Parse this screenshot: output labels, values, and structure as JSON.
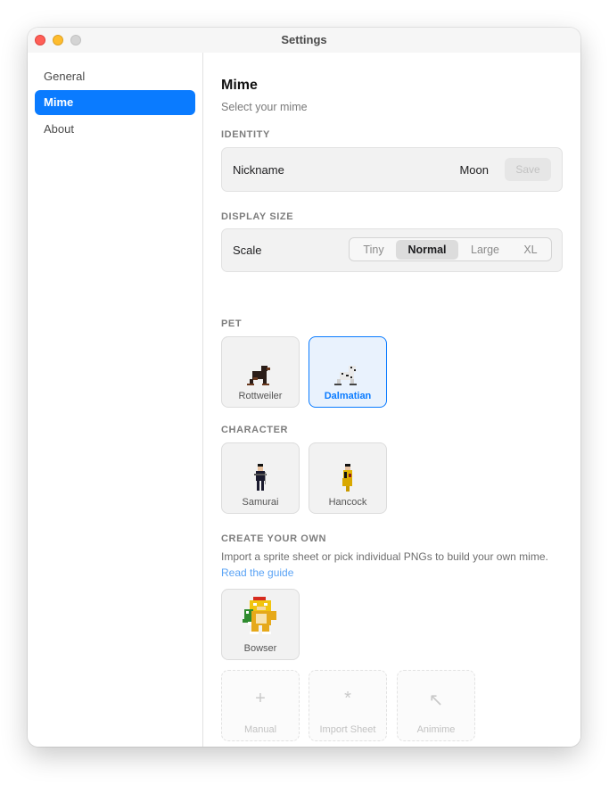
{
  "window": {
    "title": "Settings"
  },
  "sidebar": {
    "items": [
      {
        "label": "General",
        "active": false
      },
      {
        "label": "Mime",
        "active": true
      },
      {
        "label": "About",
        "active": false
      }
    ]
  },
  "main": {
    "heading": "Mime",
    "subheading": "Select your mime",
    "identity": {
      "section": "IDENTITY",
      "nickname_label": "Nickname",
      "nickname_value": "Moon",
      "save_label": "Save"
    },
    "display_size": {
      "section": "DISPLAY SIZE",
      "scale_label": "Scale",
      "options": [
        "Tiny",
        "Normal",
        "Large",
        "XL"
      ],
      "selected": "Normal"
    },
    "pet": {
      "section": "PET",
      "items": [
        {
          "label": "Rottweiler",
          "selected": false
        },
        {
          "label": "Dalmatian",
          "selected": true
        }
      ]
    },
    "character": {
      "section": "CHARACTER",
      "items": [
        {
          "label": "Samurai"
        },
        {
          "label": "Hancock"
        }
      ]
    },
    "create": {
      "section": "CREATE YOUR OWN",
      "description": "Import a sprite sheet or pick individual PNGs to build your own mime.",
      "link": "Read the guide",
      "custom": [
        {
          "label": "Bowser"
        }
      ],
      "actions": [
        {
          "label": "Manual",
          "icon": "plus-icon",
          "glyph": "+"
        },
        {
          "label": "Import Sheet",
          "icon": "asterisk-icon",
          "glyph": "*"
        },
        {
          "label": "Animime",
          "icon": "arrow-up-left-icon",
          "glyph": "↖"
        }
      ]
    }
  },
  "colors": {
    "accent": "#0a7bff",
    "link": "#5aa3f5",
    "close": "#ff5f57",
    "minimize": "#febc2e"
  }
}
